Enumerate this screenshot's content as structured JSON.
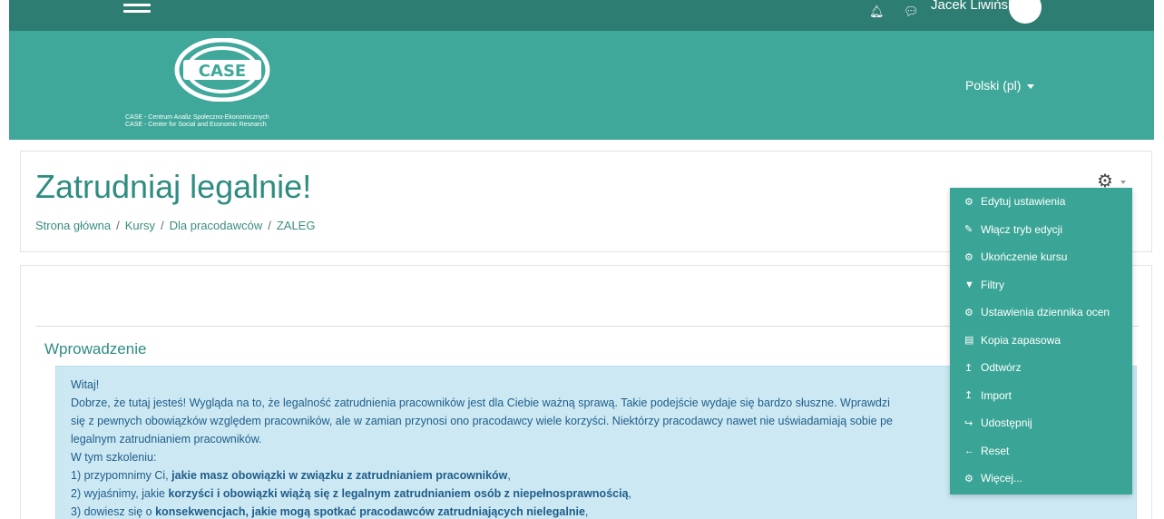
{
  "navbar": {
    "username": "Jacek Liwiński",
    "icons": [
      "hamburger-icon",
      "bell-icon",
      "chat-icon",
      "avatar"
    ]
  },
  "header": {
    "logo_text": "CASE",
    "caption_line1": "CASE - Centrum Analiz Społeczno-Ekonomicznych",
    "caption_line2": "CASE - Center for Social and Economic Research",
    "language": "Polski (pl)"
  },
  "page": {
    "title": "Zatrudniaj legalnie!",
    "breadcrumb": [
      "Strona główna",
      "Kursy",
      "Dla pracodawców",
      "ZALEG"
    ],
    "breadcrumb_separator": "/"
  },
  "action_menu": {
    "items": [
      {
        "label": "Edytuj ustawienia",
        "icon": "gear-icon",
        "glyph": "⚙"
      },
      {
        "label": "Włącz tryb edycji",
        "icon": "pencil-icon",
        "glyph": "✎"
      },
      {
        "label": "Ukończenie kursu",
        "icon": "gear-icon",
        "glyph": "⚙"
      },
      {
        "label": "Filtry",
        "icon": "filter-icon",
        "glyph": "▼"
      },
      {
        "label": "Ustawienia dziennika ocen",
        "icon": "gear-icon",
        "glyph": "⚙"
      },
      {
        "label": "Kopia zapasowa",
        "icon": "file-archive-icon",
        "glyph": "▤"
      },
      {
        "label": "Odtwórz",
        "icon": "level-up-icon",
        "glyph": "↥"
      },
      {
        "label": "Import",
        "icon": "level-up-icon",
        "glyph": "↥"
      },
      {
        "label": "Udostępnij",
        "icon": "share-icon",
        "glyph": "↪"
      },
      {
        "label": "Reset",
        "icon": "arrow-left-icon",
        "glyph": "←"
      },
      {
        "label": "Więcej...",
        "icon": "gear-icon",
        "glyph": "⚙"
      }
    ]
  },
  "content": {
    "section_title": "Wprowadzenie",
    "lines": {
      "l1": "Witaj!",
      "l2": "Dobrze, że tutaj jesteś! Wygląda na to, że legalność zatrudnienia pracowników jest dla Ciebie ważną sprawą. Takie podejście wydaje się bardzo słuszne. Wprawdzi",
      "l3": "się z pewnych obowiązków względem pracowników, ale w zamian przynosi ono pracodawcy wiele korzyści. Niektórzy pracodawcy nawet nie uświadamiają sobie pe",
      "l4": "legalnym zatrudnianiem pracowników.",
      "l5": "W tym szkoleniu:",
      "l6_pre": "1) przypomnimy Ci, ",
      "l6_bold": "jakie masz obowiązki w związku z zatrudnianiem pracowników",
      "l6_post": ",",
      "l7_pre": "2) wyjaśnimy, jakie ",
      "l7_bold": "korzyści i obowiązki wiążą się z legalnym zatrudnianiem osób z niepełnosprawnością",
      "l7_post": ",",
      "l8_pre": "3) dowiesz się o ",
      "l8_bold": "konsekwencjach, jakie mogą spotkać pracodawców zatrudniających nielegalnie",
      "l8_post": ","
    }
  },
  "colors": {
    "navbar": "#2e7d72",
    "header": "#3fa89a",
    "accent_text": "#2e8c80",
    "menu_bg": "#3aa596",
    "intro_bg": "#cce9f3",
    "intro_text": "#1f5c8a"
  }
}
